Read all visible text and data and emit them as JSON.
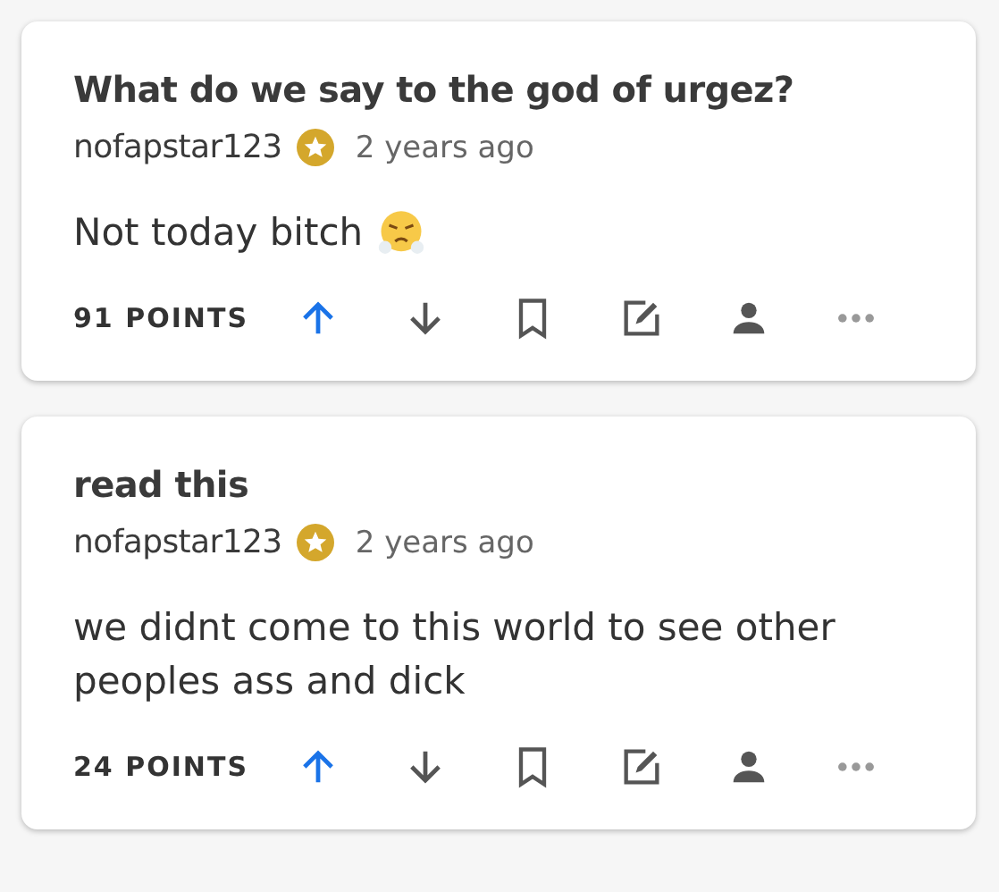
{
  "posts": [
    {
      "title": "What do we say to the god of urgez?",
      "author": "nofapstar123",
      "author_badge": true,
      "time": "2 years ago",
      "body": "Not today bitch",
      "emoji": true,
      "points": "91 POINTS",
      "upvoted": true,
      "downvoted": false
    },
    {
      "title": "read this",
      "author": "nofapstar123",
      "author_badge": true,
      "time": "2 years ago",
      "body": "we didnt come to this world to see other peoples ass and dick",
      "emoji": false,
      "points": "24 POINTS",
      "upvoted": true,
      "downvoted": false
    }
  ]
}
